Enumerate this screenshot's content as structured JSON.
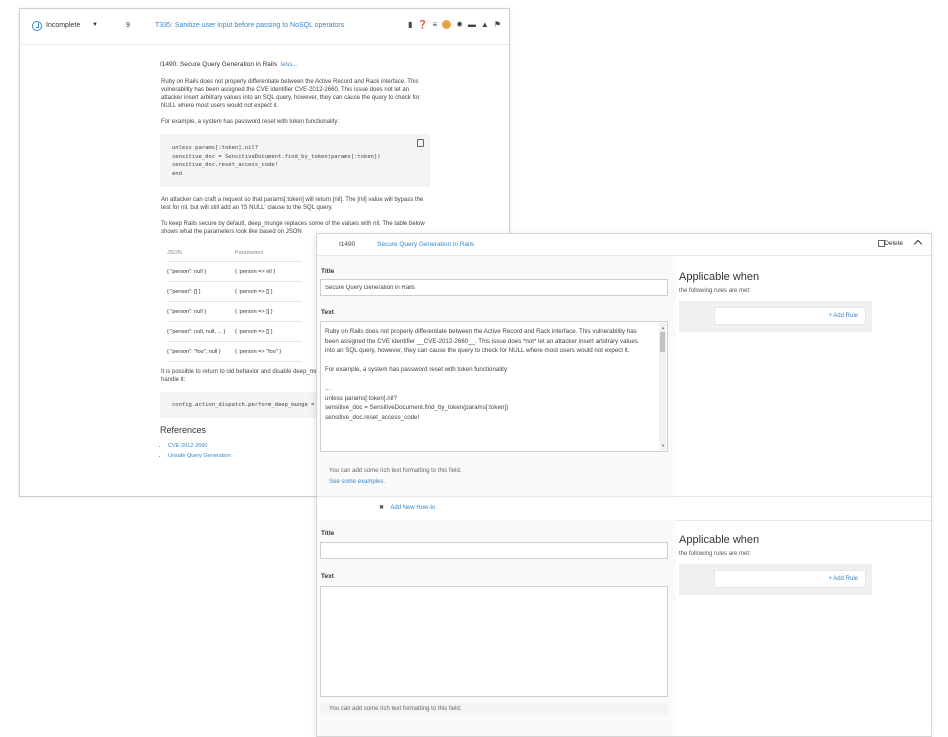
{
  "back": {
    "status": "Incomplete",
    "count": "9",
    "task_title": "T335: Sanitize user input before passing to NoSQL operators",
    "section_heading": "I1490: Secure Query Generation in Rails",
    "less_link": "less...",
    "para1": "Ruby on Rails does not properly differentiate between the Active Record and Rack interface. This vulnerability has been assigned the CVE identifier CVE-2012-2660. This issue does not let an attacker insert arbitrary values into an SQL query, however, they can cause the query to check for NULL where most users would not expect it.",
    "para2": "For example, a system has password reset with token functionality:",
    "code_lines": [
      "unless params[:token].nil?",
      "    sensitive_doc = SensitiveDocument.find_by_token(params[:token])",
      "    sensitive_doc.reset_access_code!",
      "end"
    ],
    "para3": "An attacker can craft a request so that params[:token] will return [nil]. The [nil] value will bypass the test for nil, but will still add an 'IS NULL' clause to the SQL query.",
    "para4": "To keep Rails secure by default, deep_munge replaces some of the values with nil. The table below shows what the parameters look like based on JSON",
    "table_headers": [
      "JSON",
      "Parameters"
    ],
    "table_rows": [
      [
        "{ \"person\": null }",
        "{ :person => nil }"
      ],
      [
        "{ \"person\": [] }",
        "{ :person => [] }"
      ],
      [
        "{ \"person\": null }",
        "{ :person => [] }"
      ],
      [
        "{ \"person\": null, null, ... }",
        "{ :person => [] }"
      ],
      [
        "{ \"person\": \"foo\", null }",
        "{ :person => \"foo\" }"
      ]
    ],
    "para5": "It is possible to return to old behavior and disable deep_mu are aware of the risk and know how to handle it:",
    "code2": "config.action_dispatch.perform_deep_munge =",
    "refs_title": "References",
    "refs": [
      "CVE-2012-2660",
      "Unsafe Query Generation"
    ]
  },
  "front": {
    "id": "I1490",
    "title_link": "Secure Query Generation in Rails",
    "delete_label": "Delete",
    "title_label": "Title",
    "title_value": "Secure Query Generation in Rails",
    "text_label": "Text",
    "text_lines": [
      "Ruby on Rails does not properly differentiate between the Active Record and Rack interface. This vulnerability has",
      "been assigned the CVE identifier __CVE-2012-2660__. This issue does *not* let an attacker insert arbitrary values",
      "into an SQL query, however, they can cause the query to check for NULL where most users would not expect it.",
      "",
      "For example, a system has password reset with token functionality:",
      "",
      "...",
      "unless params[:token].nil?",
      "   sensitive_doc = SensitiveDocument.find_by_token(params[:token])",
      "   sensitive_doc.reset_access_code!"
    ],
    "hint": "You can add some rich text formatting to this field.",
    "examples_link": "See some examples.",
    "applicable_title": "Applicable when",
    "applicable_sub": "the following rules are met:",
    "add_rule": "+ Add Rule",
    "add_howto": "Add New How-to",
    "title2_label": "Title",
    "title2_value": "",
    "text2_label": "Text",
    "hint2": "You can add some rich text formatting to this field."
  },
  "colors": {
    "link": "#3a86c8",
    "accent_orange": "#e9a441"
  }
}
